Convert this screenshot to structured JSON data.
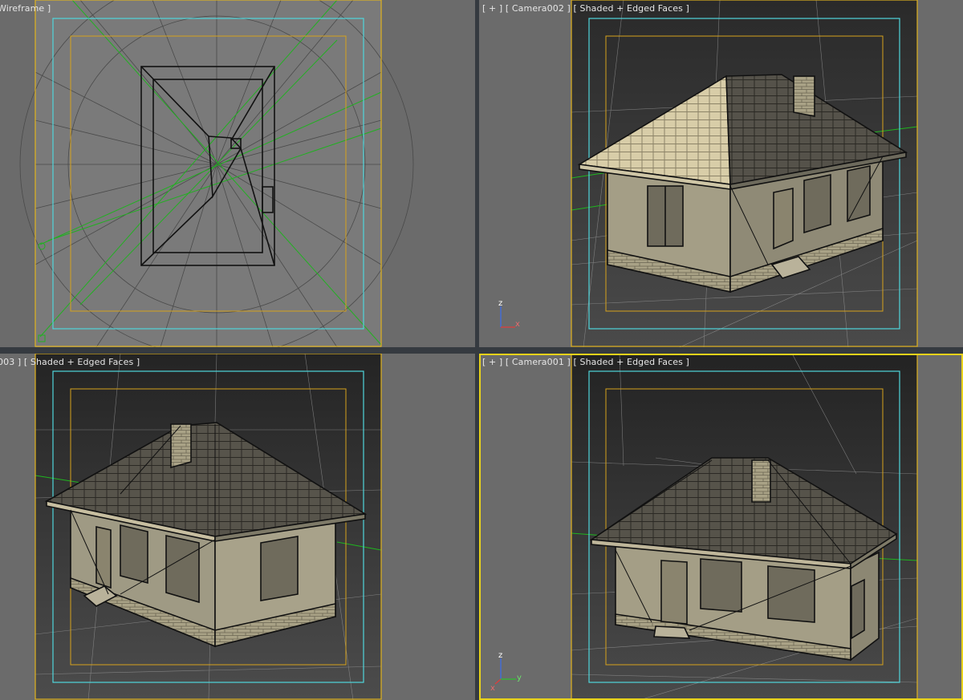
{
  "viewports": {
    "top_left": {
      "label": "Wireframe ]"
    },
    "top_right": {
      "label": "[ + ] [ Camera002 ] [ Shaded + Edged Faces ]"
    },
    "bottom_left": {
      "label": "003 ] [ Shaded + Edged Faces ]"
    },
    "bottom_right": {
      "label": "[ + ] [ Camera001 ] [ Shaded + Edged Faces ]"
    }
  },
  "axis_gizmo": {
    "top_right": {
      "z": "z",
      "x": "x"
    },
    "bottom_right": {
      "z": "z",
      "x": "x",
      "y": "y"
    }
  },
  "colors": {
    "safe_frame_outer": "#e0b21e",
    "safe_frame_action": "#4fd6dc",
    "safe_frame_title": "#d6a21c",
    "grid_green": "#1fb51f",
    "active_border": "#e8d21a"
  },
  "active_viewport": "bottom_right"
}
